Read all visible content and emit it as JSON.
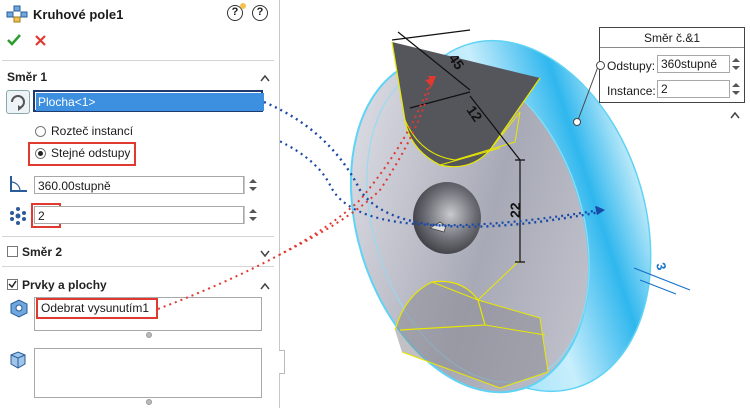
{
  "panel": {
    "title": "Kruhové pole1",
    "help_glyph": "?",
    "ok_icon": "check-icon",
    "cancel_icon": "x-icon",
    "direction1": {
      "label": "Směr 1",
      "axis_value": "Plocha<1>",
      "radio_options": [
        "Rozteč instancí",
        "Stejné odstupy"
      ],
      "selected_option": "Stejné odstupy",
      "angle_value": "360.00stupně",
      "count_value": "2"
    },
    "direction2": {
      "label": "Směr 2",
      "checked": false
    },
    "features": {
      "label": "Prvky a plochy",
      "checked": true,
      "feature_item": "Odebrat vysunutím1"
    }
  },
  "callout": {
    "title": "Směr č.&1",
    "spacing_label": "Odstupy:",
    "spacing_value": "360stupně",
    "instances_label": "Instance:",
    "instances_value": "2"
  },
  "dimensions": [
    "12",
    "45",
    "22",
    "3"
  ],
  "colors": {
    "accent_blue": "#1a73c8",
    "selection_fill": "#3d8fe0",
    "highlight_red": "#e0392f",
    "part_edge": "#5fd3f5",
    "sketch_yellow": "#e8e800",
    "ok_green": "#2e9b2e"
  }
}
